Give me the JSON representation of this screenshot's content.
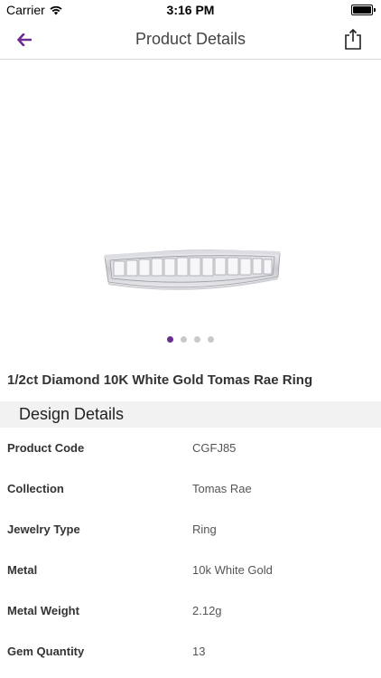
{
  "status_bar": {
    "carrier": "Carrier",
    "time": "3:16 PM"
  },
  "nav": {
    "title": "Product Details"
  },
  "colors": {
    "accent": "#6a2d91"
  },
  "gallery": {
    "page_count": 4,
    "active_page": 1
  },
  "product": {
    "title": "1/2ct Diamond 10K White Gold Tomas Rae Ring"
  },
  "design_details": {
    "header": "Design Details",
    "rows": [
      {
        "label": "Product Code",
        "value": "CGFJ85"
      },
      {
        "label": "Collection",
        "value": "Tomas Rae"
      },
      {
        "label": "Jewelry Type",
        "value": "Ring"
      },
      {
        "label": "Metal",
        "value": "10k White Gold"
      },
      {
        "label": "Metal Weight",
        "value": "2.12g"
      },
      {
        "label": "Gem Quantity",
        "value": "13"
      }
    ]
  }
}
